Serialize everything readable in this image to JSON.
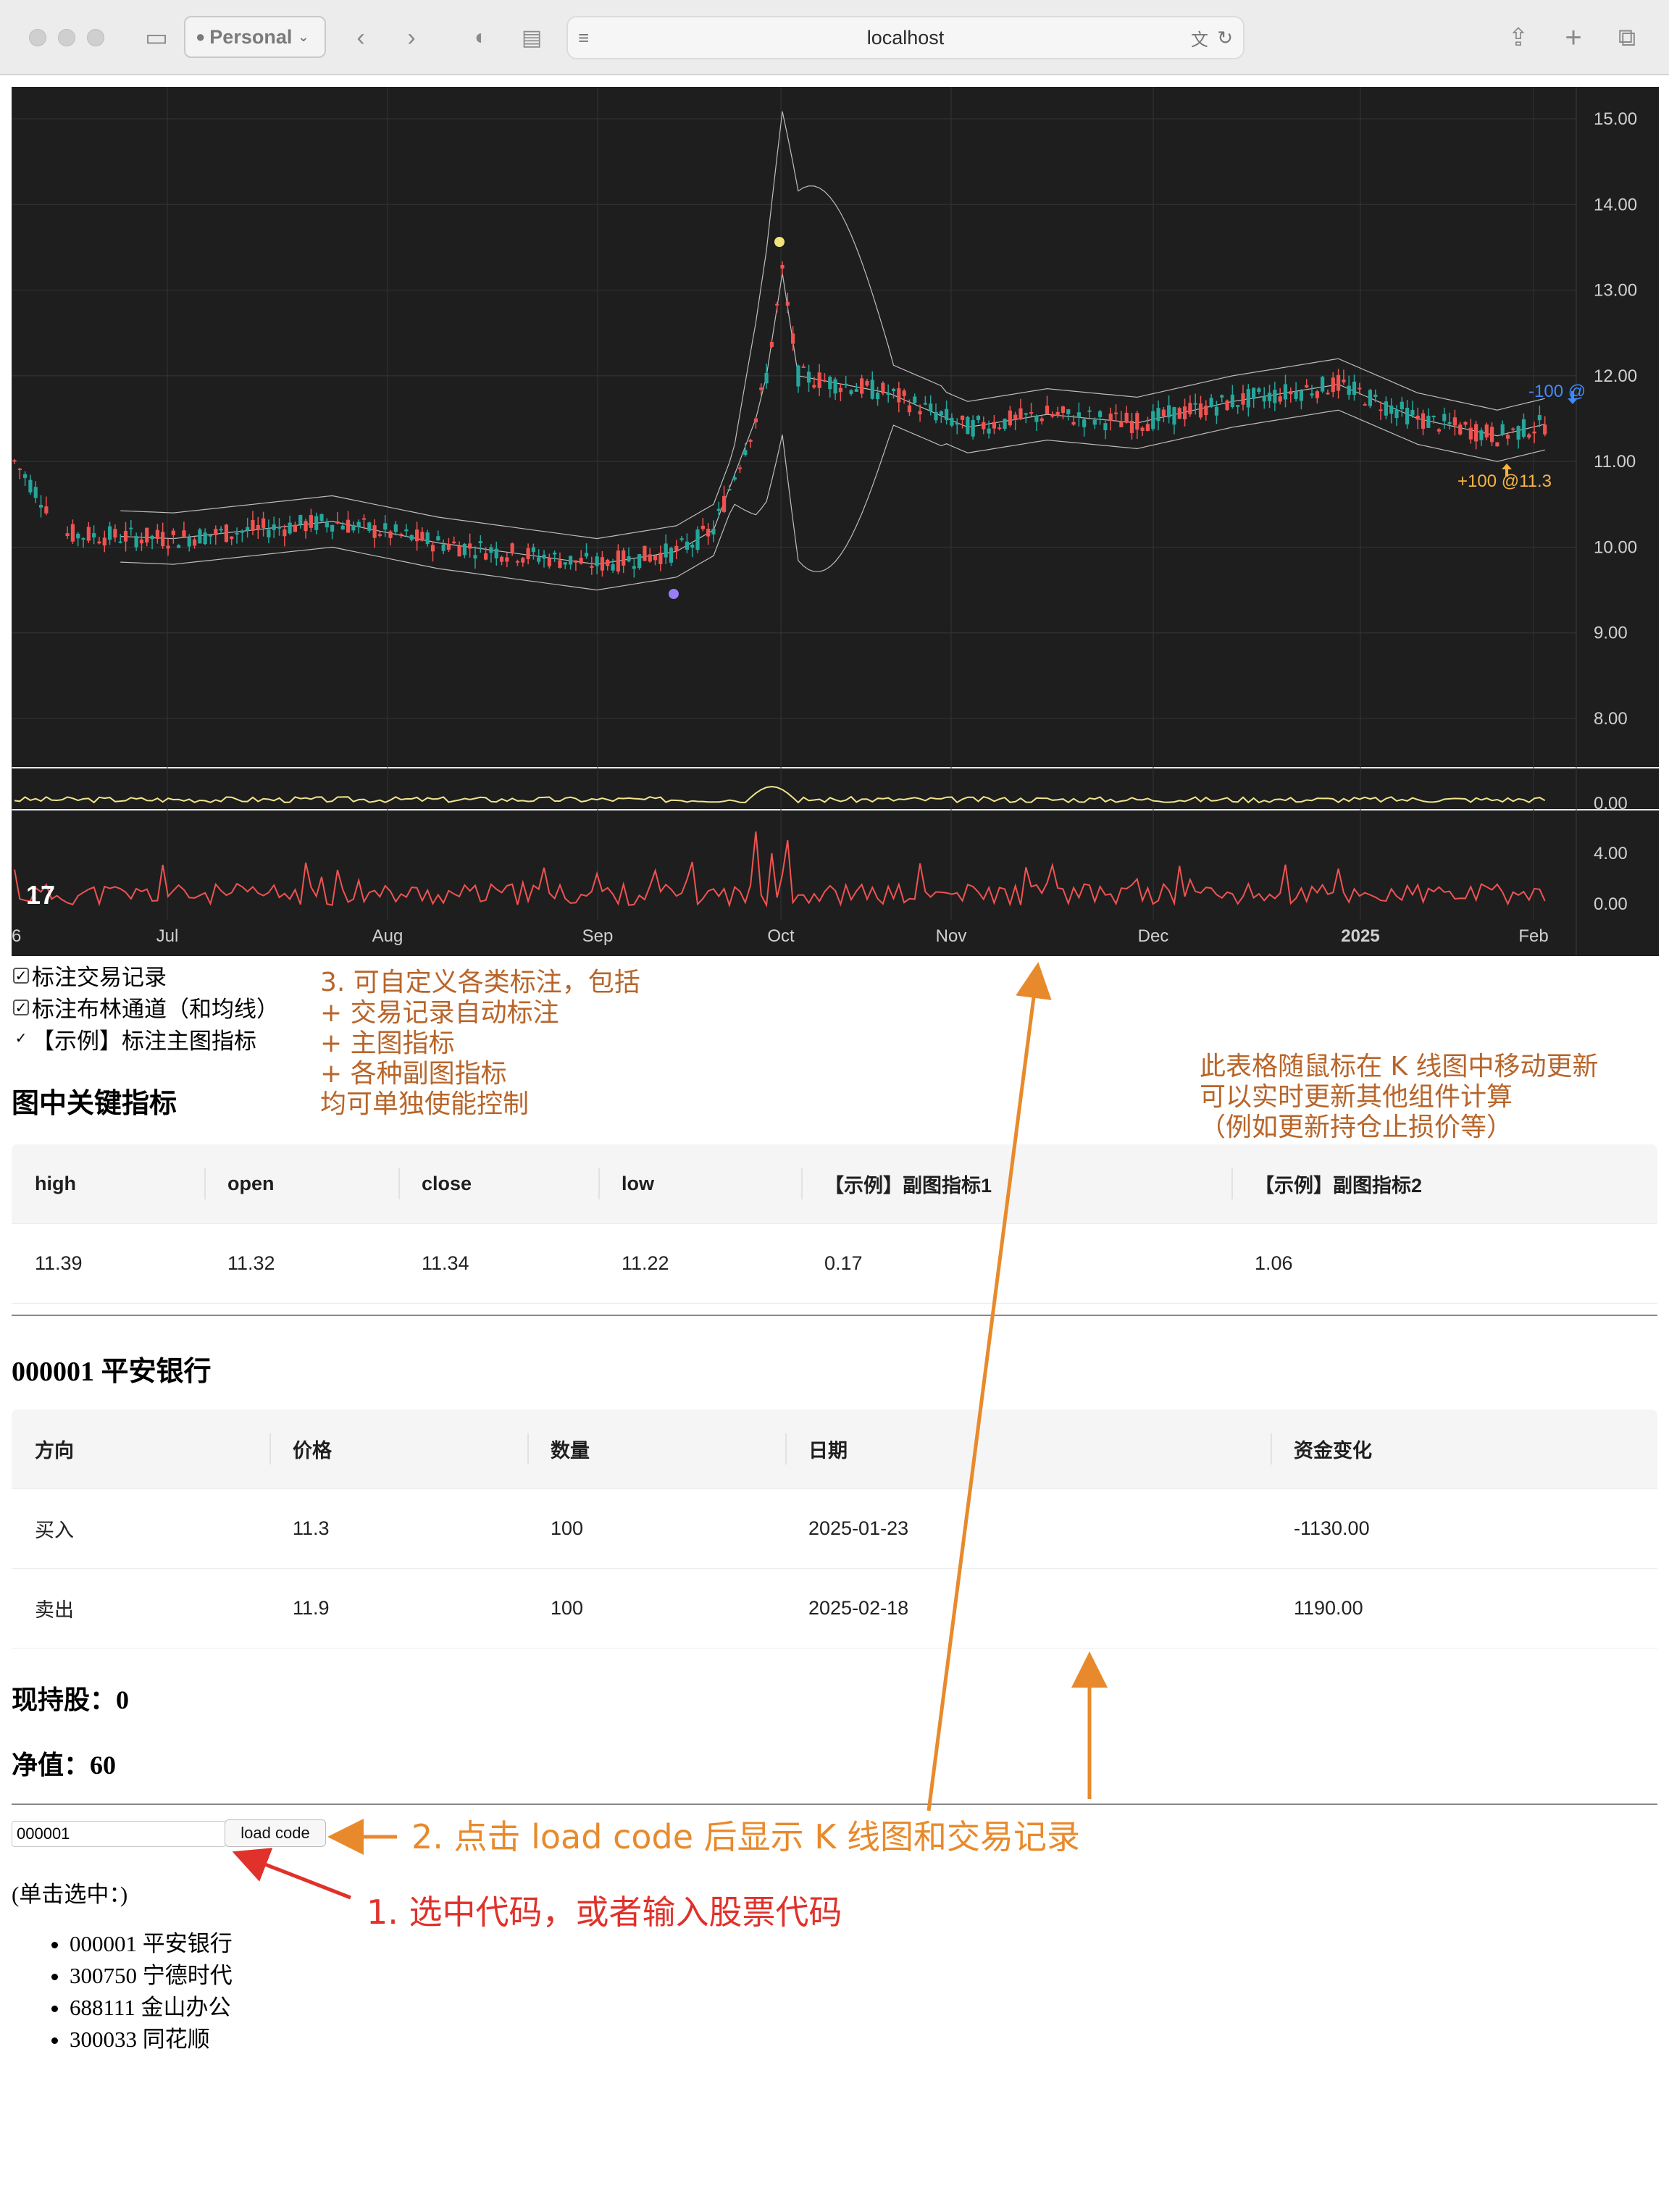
{
  "browser": {
    "profile_label": "Personal",
    "url": "localhost"
  },
  "chart": {
    "y_ticks": [
      "15.00",
      "14.00",
      "13.00",
      "12.00",
      "11.00",
      "10.00",
      "9.00",
      "8.00"
    ],
    "pane2_ticks": [
      "0.00"
    ],
    "pane3_ticks": [
      "4.00",
      "0.00"
    ],
    "x_ticks": [
      "6",
      "Jul",
      "Aug",
      "Sep",
      "Oct",
      "Nov",
      "Dec",
      "2025",
      "Feb"
    ],
    "sell_marker": "-100 @",
    "buy_marker": "+100 @11.3",
    "colors": {
      "up": "#ef5350",
      "down": "#26a69a",
      "band": "#bdbdbd",
      "sub1": "#f0e68c",
      "sub2": "#ef5350",
      "buy": "#f5b342",
      "sell": "#3d8bfd",
      "high_dot": "#f3e37c",
      "low_dot": "#9b7cf6"
    }
  },
  "checkboxes": [
    {
      "label": "标注交易记录",
      "checked": true
    },
    {
      "label": "标注布林通道（和均线）",
      "checked": true
    },
    {
      "label": "【示例】标注主图指标",
      "checked": true
    }
  ],
  "indicators": {
    "title": "图中关键指标",
    "headers": [
      "high",
      "open",
      "close",
      "low",
      "【示例】副图指标1",
      "【示例】副图指标2"
    ],
    "values": [
      "11.39",
      "11.32",
      "11.34",
      "11.22",
      "0.17",
      "1.06"
    ]
  },
  "stock": {
    "title": "000001 平安银行",
    "headers": [
      "方向",
      "价格",
      "数量",
      "日期",
      "资金变化"
    ],
    "rows": [
      [
        "买入",
        "11.3",
        "100",
        "2025-01-23",
        "-1130.00"
      ],
      [
        "卖出",
        "11.9",
        "100",
        "2025-02-18",
        "1190.00"
      ]
    ],
    "holding": "现持股：0",
    "net": "净值：60"
  },
  "controls": {
    "code_value": "000001",
    "load_label": "load code",
    "hint": "(单击选中：)",
    "list": [
      "000001 平安银行",
      "300750 宁德时代",
      "688111 金山办公",
      "300033 同花顺"
    ]
  },
  "annotations": {
    "a3": [
      "3. 可自定义各类标注，包括",
      "+ 交易记录自动标注",
      "+ 主图指标",
      "+ 各种副图指标",
      "均可单独使能控制"
    ],
    "right_note": [
      "此表格随鼠标在 K 线图中移动更新",
      "可以实时更新其他组件计算",
      "（例如更新持仓止损价等）"
    ],
    "a2": "2. 点击 load code 后显示 K 线图和交易记录",
    "a1": "1. 选中代码，或者输入股票代码"
  }
}
